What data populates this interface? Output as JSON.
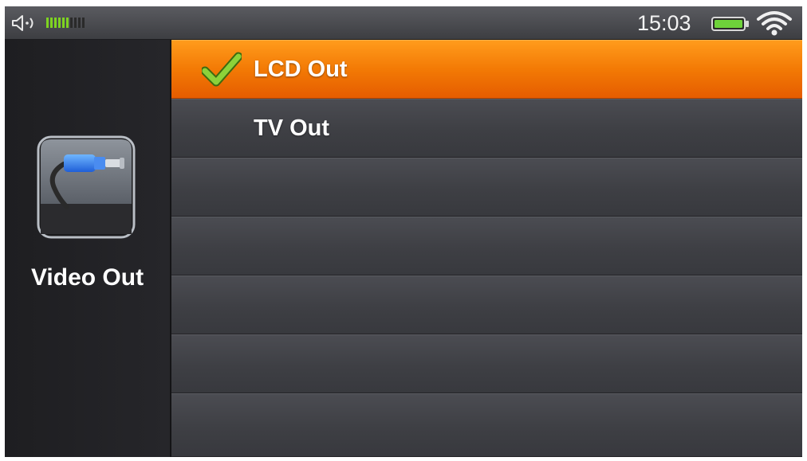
{
  "statusbar": {
    "time": "15:03",
    "volume_level": 6,
    "volume_max": 10,
    "icons": [
      "speaker-icon",
      "battery-icon",
      "wifi-icon"
    ]
  },
  "sidebar": {
    "title": "Video Out",
    "icon": "video-cable-icon"
  },
  "menu": {
    "items": [
      {
        "label": "LCD Out",
        "selected": true
      },
      {
        "label": "TV Out",
        "selected": false
      },
      {
        "label": "",
        "selected": false
      },
      {
        "label": "",
        "selected": false
      },
      {
        "label": "",
        "selected": false
      },
      {
        "label": "",
        "selected": false
      },
      {
        "label": "",
        "selected": false
      }
    ]
  },
  "colors": {
    "accent": "#f37a05",
    "volume_on": "#7ed321",
    "battery": "#6ed23a",
    "check": "#8cd23a"
  }
}
